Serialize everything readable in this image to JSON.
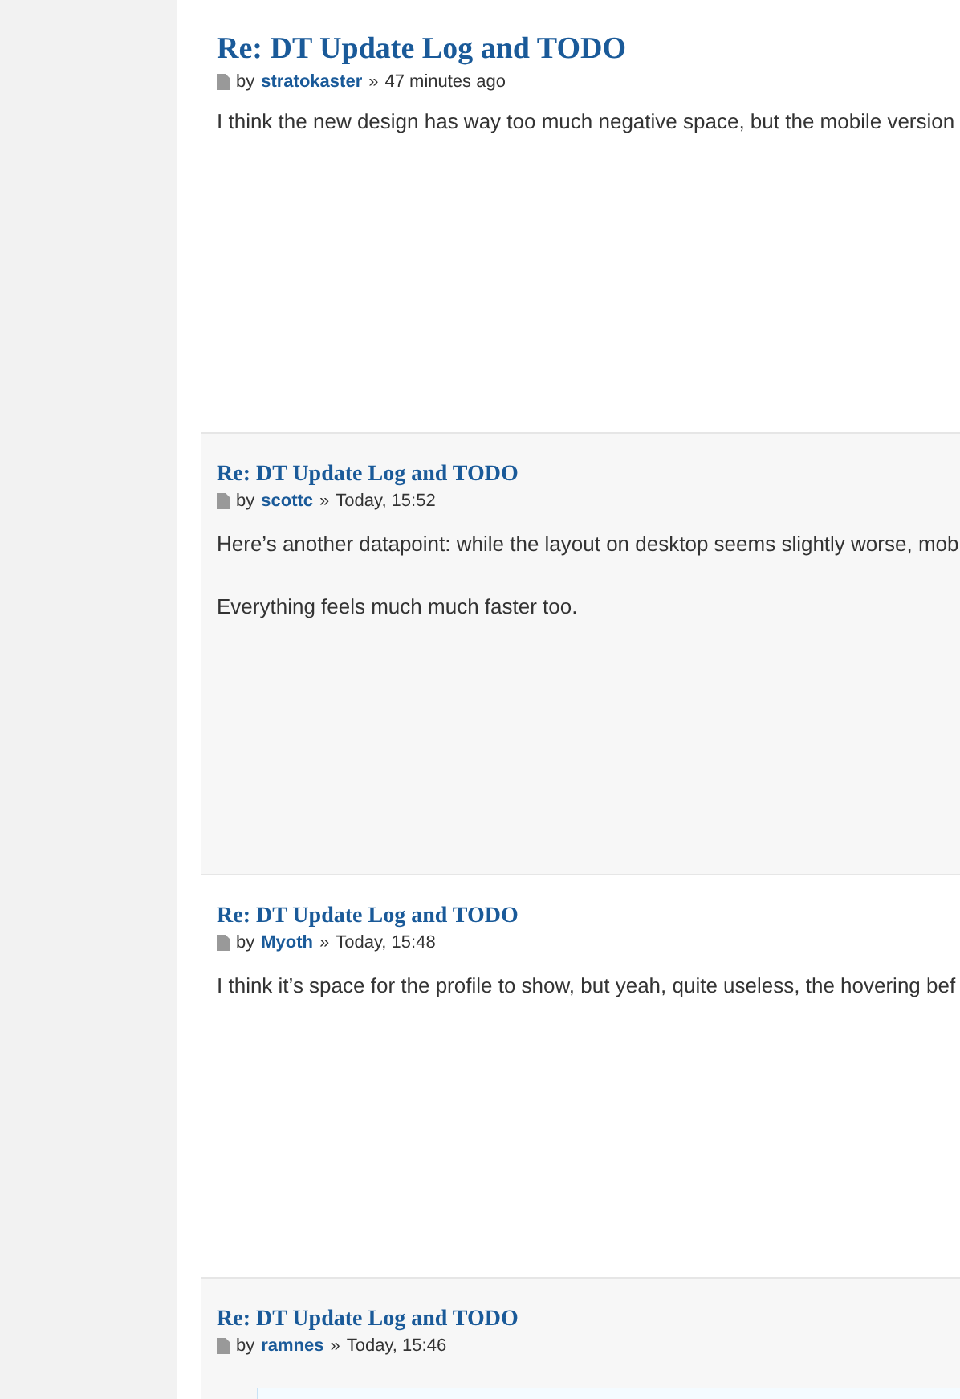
{
  "posts": [
    {
      "title": "Re: DT Update Log and TODO",
      "by": "by",
      "author": "stratokaster",
      "separator": "»",
      "time": "47 minutes ago",
      "paragraphs": [
        "I think the new design has way too much negative space, but the mobile version"
      ]
    },
    {
      "title": "Re: DT Update Log and TODO",
      "by": "by",
      "author": "scottc",
      "separator": "»",
      "time": "Today, 15:52",
      "paragraphs": [
        "Here’s another datapoint: while the layout on desktop seems slightly worse, mob",
        "Everything feels much much faster too."
      ]
    },
    {
      "title": "Re: DT Update Log and TODO",
      "by": "by",
      "author": "Myoth",
      "separator": "»",
      "time": "Today, 15:48",
      "paragraphs": [
        "I think it’s space for the profile to show, but yeah, quite useless, the hovering bef"
      ]
    },
    {
      "title": "Re: DT Update Log and TODO",
      "by": "by",
      "author": "ramnes",
      "separator": "»",
      "time": "Today, 15:46",
      "quote": true
    }
  ]
}
